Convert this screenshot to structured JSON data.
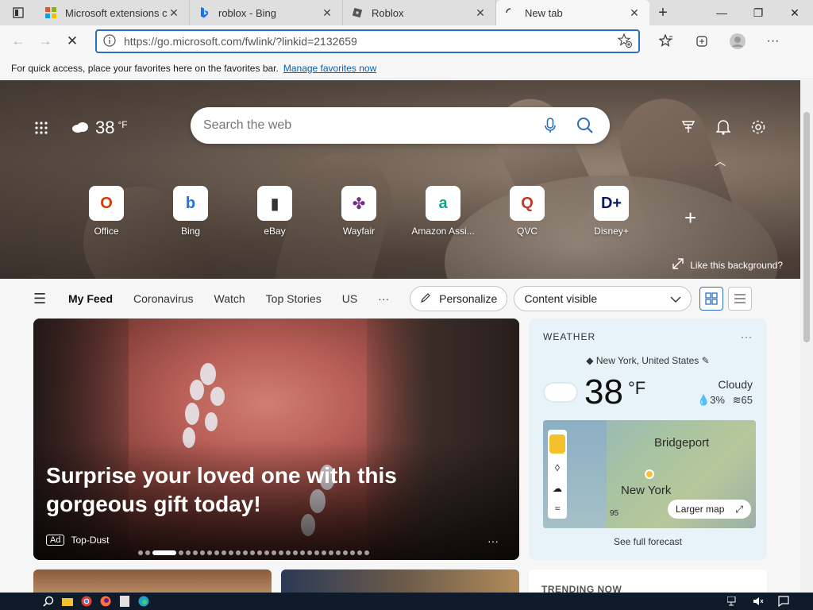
{
  "tabs": [
    {
      "title": "Microsoft extensions co",
      "favicon": "microsoft-logo-icon",
      "active": false
    },
    {
      "title": "roblox - Bing",
      "favicon": "bing-logo-icon",
      "active": false
    },
    {
      "title": "Roblox",
      "favicon": "roblox-logo-icon",
      "active": false
    },
    {
      "title": "New tab",
      "favicon": "loading-icon",
      "active": true
    }
  ],
  "address": {
    "url": "https://go.microsoft.com/fwlink/?linkid=2132659"
  },
  "favbar": {
    "text": "For quick access, place your favorites here on the favorites bar.",
    "link": "Manage favorites now"
  },
  "hero": {
    "weather_temp": "38",
    "weather_unit": "°F",
    "search_placeholder": "Search the web",
    "like_bg": "Like this background?"
  },
  "quick_links": [
    {
      "label": "Office",
      "icon": "office-logo-icon",
      "color": "#d83b01",
      "glyph": "O"
    },
    {
      "label": "Bing",
      "icon": "bing-logo-icon",
      "color": "#1a73e8",
      "glyph": "b"
    },
    {
      "label": "eBay",
      "icon": "ebay-logo-icon",
      "color": "#333333",
      "glyph": "▮"
    },
    {
      "label": "Wayfair",
      "icon": "wayfair-logo-icon",
      "color": "#7b2d8e",
      "glyph": "✤"
    },
    {
      "label": "Amazon Assi...",
      "icon": "amazon-assistant-icon",
      "color": "#0fa58d",
      "glyph": "a"
    },
    {
      "label": "QVC",
      "icon": "qvc-logo-icon",
      "color": "#c0392b",
      "glyph": "Q"
    },
    {
      "label": "Disney+",
      "icon": "disney-plus-icon",
      "color": "#0b1e5b",
      "glyph": "D+"
    }
  ],
  "feed_nav": {
    "items": [
      "My Feed",
      "Coronavirus",
      "Watch",
      "Top Stories",
      "US"
    ],
    "more": "···",
    "personalize": "Personalize",
    "content_visible": "Content visible"
  },
  "big_card": {
    "headline": "Surprise your loved one with this gorgeous gift today!",
    "ad_label": "Ad",
    "source": "Top-Dust",
    "more": "···"
  },
  "weather": {
    "heading": "WEATHER",
    "more": "···",
    "location": "New York, United States",
    "temp": "38",
    "unit": "°F",
    "condition": "Cloudy",
    "precip": "3%",
    "wind": "65",
    "map_cities": [
      "Bridgeport",
      "New York"
    ],
    "road_marker": "95",
    "larger_map": "Larger map",
    "full_forecast": "See full forecast"
  },
  "trending": {
    "heading": "TRENDING NOW"
  },
  "colors": {
    "accent": "#2d6fbf",
    "link": "#0a5ea8"
  }
}
